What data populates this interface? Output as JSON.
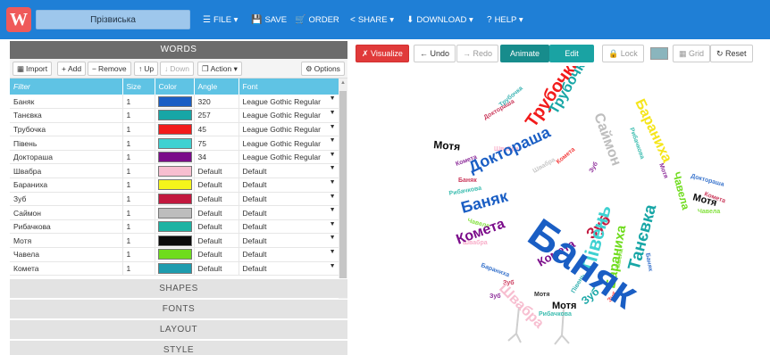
{
  "app": {
    "logo_letter": "W",
    "title": "Прізвиська",
    "menu": [
      {
        "icon": "☰",
        "label": "FILE ▾"
      },
      {
        "icon": "💾",
        "label": "SAVE"
      },
      {
        "icon": "🛒",
        "label": "ORDER"
      },
      {
        "icon": "<",
        "label": "SHARE ▾"
      },
      {
        "icon": "⬇",
        "label": "DOWNLOAD ▾"
      },
      {
        "icon": "?",
        "label": "HELP ▾"
      }
    ]
  },
  "words_panel": {
    "header": "WORDS",
    "toolbar": {
      "import": "Import",
      "add": "Add",
      "remove": "Remove",
      "up": "Up",
      "down": "Down",
      "action": "Action ▾",
      "options": "Options"
    },
    "columns": [
      "Filter",
      "Size",
      "Color",
      "Angle",
      "Font"
    ],
    "rows": [
      {
        "word": "Баняк",
        "size": "1",
        "color": "#1a5ec4",
        "angle": "320",
        "font": "League Gothic Regular"
      },
      {
        "word": "Танєвка",
        "size": "1",
        "color": "#17a6a6",
        "angle": "257",
        "font": "League Gothic Regular"
      },
      {
        "word": "Трубочка",
        "size": "1",
        "color": "#f21b1b",
        "angle": "45",
        "font": "League Gothic Regular"
      },
      {
        "word": "Півень",
        "size": "1",
        "color": "#3fd1d1",
        "angle": "75",
        "font": "League Gothic Regular"
      },
      {
        "word": "Доктораша",
        "size": "1",
        "color": "#7b0c8a",
        "angle": "34",
        "font": "League Gothic Regular"
      },
      {
        "word": "Швабра",
        "size": "1",
        "color": "#f7bed0",
        "angle": "Default",
        "font": "Default"
      },
      {
        "word": "Бараниха",
        "size": "1",
        "color": "#f5f51b",
        "angle": "Default",
        "font": "Default"
      },
      {
        "word": "Зуб",
        "size": "1",
        "color": "#c2183f",
        "angle": "Default",
        "font": "Default"
      },
      {
        "word": "Саймон",
        "size": "1",
        "color": "#bdbdbd",
        "angle": "Default",
        "font": "Default"
      },
      {
        "word": "Рибачкова",
        "size": "1",
        "color": "#1db3a3",
        "angle": "Default",
        "font": "Default"
      },
      {
        "word": "Мотя",
        "size": "1",
        "color": "#0a0a0a",
        "angle": "Default",
        "font": "Default"
      },
      {
        "word": "Чавела",
        "size": "1",
        "color": "#6fdc1d",
        "angle": "Default",
        "font": "Default"
      },
      {
        "word": "Комета",
        "size": "1",
        "color": "#1d9cae",
        "angle": "Default",
        "font": "Default"
      }
    ]
  },
  "sections": [
    "SHAPES",
    "FONTS",
    "LAYOUT",
    "STYLE"
  ],
  "canvas_toolbar": {
    "visualize": "Visualize",
    "undo": "Undo",
    "redo": "Redo",
    "animate": "Animate",
    "edit": "Edit",
    "lock": "Lock",
    "grid": "Grid",
    "reset": "Reset"
  }
}
